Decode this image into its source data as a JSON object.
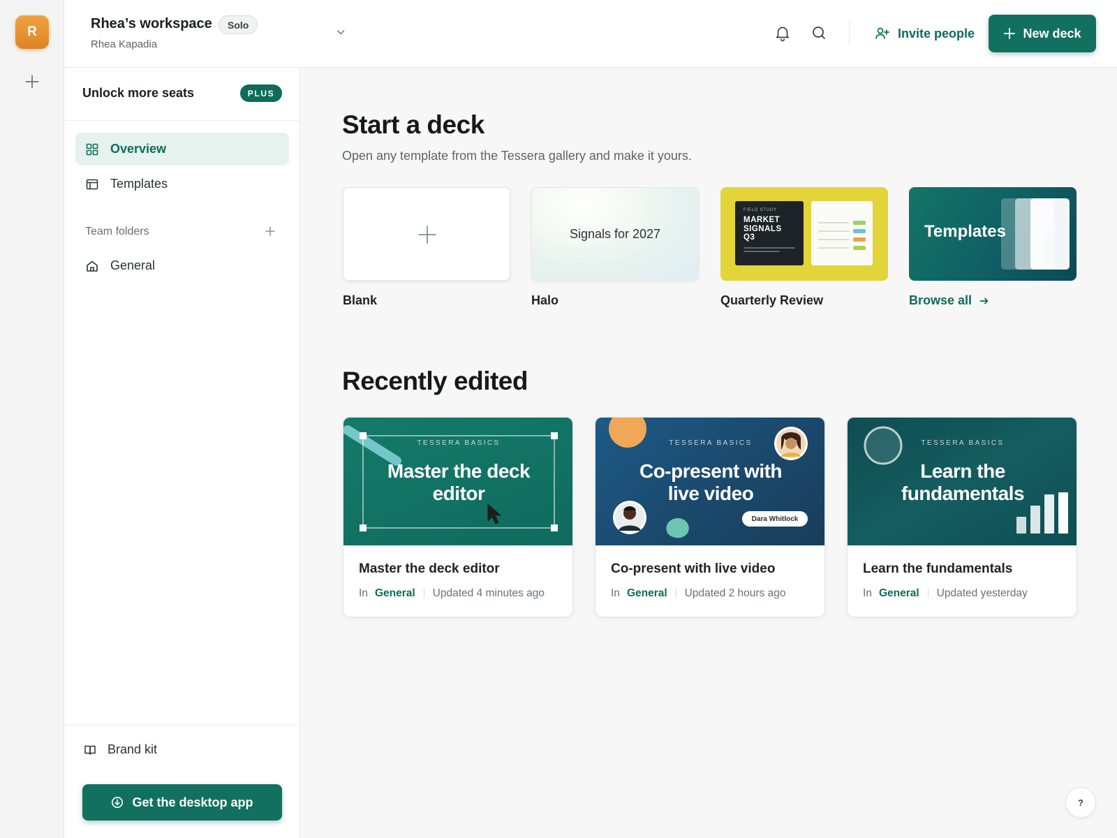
{
  "rail": {
    "avatar_letter": "R",
    "add_icon": "plus-icon"
  },
  "header": {
    "workspace_title": "Rhea’s workspace",
    "plan_badge": "Solo",
    "user_name": "Rhea Kapadia",
    "invite_label": "Invite people",
    "new_deck_label": "New deck",
    "icons": [
      "chevron-down-icon",
      "bell-icon",
      "search-icon",
      "user-plus-icon",
      "plus-icon"
    ]
  },
  "sidebar": {
    "unlock_label": "Unlock more seats",
    "plus_badge": "PLUS",
    "nav": [
      {
        "label": "Overview",
        "icon": "grid-icon",
        "active": true
      },
      {
        "label": "Templates",
        "icon": "layout-icon",
        "active": false
      }
    ],
    "team_folders_label": "Team folders",
    "folders": [
      {
        "label": "General",
        "icon": "home-icon"
      }
    ],
    "brand_kit_label": "Brand kit",
    "desktop_app_label": "Get the desktop app"
  },
  "start": {
    "title": "Start a deck",
    "subtitle": "Open any template from the Tessera gallery and make it yours.",
    "templates": [
      {
        "label": "Blank"
      },
      {
        "label": "Halo",
        "thumb_text": "Signals for 2027"
      },
      {
        "label": "Quarterly Review",
        "thumb_kicker": "FIELD STUDY",
        "thumb_title": "MARKET SIGNALS Q3"
      },
      {
        "thumb_text": "Templates"
      }
    ],
    "browse_all_label": "Browse all"
  },
  "recent": {
    "title": "Recently edited",
    "decks": [
      {
        "kicker": "TESSERA BASICS",
        "thumb_title": "Master the deck editor",
        "title": "Master the deck editor",
        "in_label": "In",
        "folder": "General",
        "updated": "Updated 4 minutes ago"
      },
      {
        "kicker": "TESSERA BASICS",
        "thumb_title": "Co-present with live video",
        "presenter_name": "Dara Whitlock",
        "title": "Co-present with live video",
        "in_label": "In",
        "folder": "General",
        "updated": "Updated 2 hours ago"
      },
      {
        "kicker": "TESSERA BASICS",
        "thumb_title": "Learn the fundamentals",
        "title": "Learn the fundamentals",
        "in_label": "In",
        "folder": "General",
        "updated": "Updated yesterday"
      }
    ]
  },
  "help_label": "?",
  "colors": {
    "brand": "#127060",
    "accent_text": "#0f6b5a",
    "avatar": "#e8922f",
    "active_nav_bg": "#e6f2ee"
  }
}
